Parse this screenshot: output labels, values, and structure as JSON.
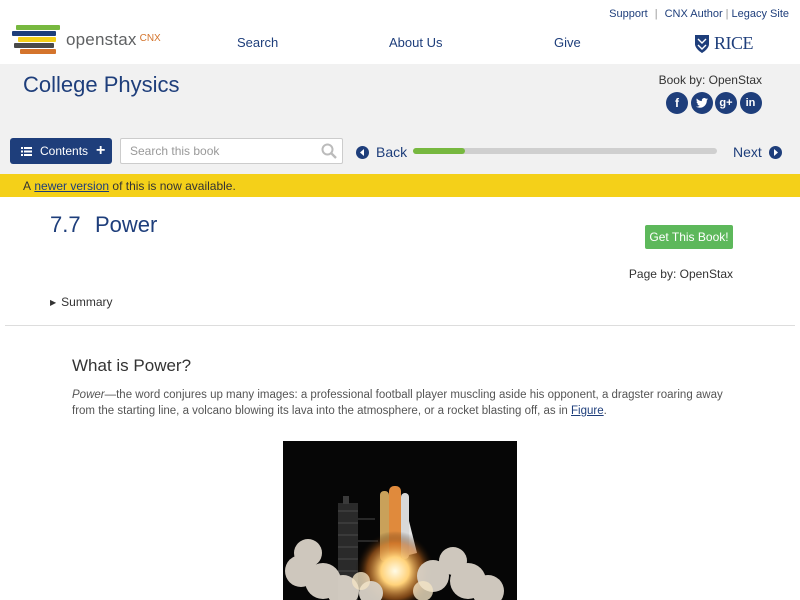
{
  "utility": {
    "support": "Support",
    "cnx_author": "CNX Author",
    "legacy_site": "Legacy Site"
  },
  "header": {
    "logo_text": "openstax",
    "logo_suffix": "CNX",
    "nav": [
      "Search",
      "About Us",
      "Give"
    ],
    "partner": "RICE"
  },
  "book": {
    "title": "College Physics",
    "book_by": "Book by: OpenStax",
    "socials": [
      "facebook-icon",
      "twitter-icon",
      "google-plus-icon",
      "linkedin-icon"
    ]
  },
  "toolbar": {
    "contents_label": "Contents",
    "search_placeholder": "Search this book",
    "back_label": "Back",
    "next_label": "Next",
    "progress": 0.17
  },
  "notice": {
    "prefix": "A ",
    "link": "newer version",
    "suffix": " of this is now available."
  },
  "section": {
    "number": "7.7",
    "title": "Power",
    "get_book": "Get This Book!",
    "page_by": "Page by: OpenStax",
    "summary": "Summary"
  },
  "content": {
    "heading": "What is Power?",
    "para_em": "Power",
    "para_text": "—the word conjures up many images: a professional football player muscling aside his opponent, a dragster roaring away from the starting line, a volcano blowing its lava into the atmosphere, or a rocket blasting off, as in ",
    "para_link": "Figure",
    "para_end": "."
  },
  "colors": {
    "brand_blue": "#1e3e7b",
    "notice_yellow": "#f4d019",
    "progress_green": "#77b83f",
    "button_green": "#5db85b"
  }
}
